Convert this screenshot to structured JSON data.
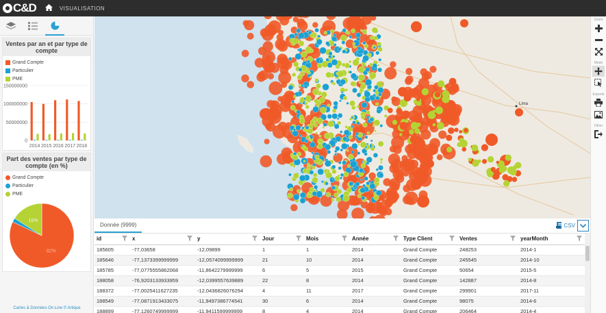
{
  "app": {
    "logo": "C&D",
    "nav_title": "VISUALISATION"
  },
  "sidebar": {
    "bar_panel": {
      "title": "Ventes par an et par type de compte",
      "legend": [
        {
          "label": "Grand Compte",
          "color": "#f05a28"
        },
        {
          "label": "Particulier",
          "color": "#1ba1d2"
        },
        {
          "label": "PME",
          "color": "#b5d334"
        }
      ]
    },
    "pie_panel": {
      "title": "Part des ventes par type de compte (en %)",
      "legend": [
        {
          "label": "Grand Compte",
          "color": "#f05a28"
        },
        {
          "label": "Particulier",
          "color": "#1ba1d2"
        },
        {
          "label": "PME",
          "color": "#b5d334"
        }
      ]
    },
    "footer": "Cartes & Données On Line © Artique"
  },
  "chart_data": [
    {
      "type": "bar",
      "title": "Ventes par an et par type de compte",
      "categories": [
        "2014",
        "2015",
        "2016",
        "2017",
        "2018"
      ],
      "y_ticks": [
        "150000000",
        "100000000",
        "50000000",
        "0"
      ],
      "ylim": [
        0,
        150000000
      ],
      "series": [
        {
          "name": "Grand Compte",
          "values": [
            105000000,
            100000000,
            110000000,
            112000000,
            108000000
          ]
        },
        {
          "name": "Particulier",
          "values": [
            1500000,
            1400000,
            1600000,
            1500000,
            1400000
          ]
        },
        {
          "name": "PME",
          "values": [
            18000000,
            17000000,
            19000000,
            20000000,
            19000000
          ]
        }
      ]
    },
    {
      "type": "pie",
      "title": "Part des ventes par type de compte (en %)",
      "series": [
        {
          "name": "Grand Compte",
          "value": 82
        },
        {
          "name": "Particulier",
          "value": 2
        },
        {
          "name": "PME",
          "value": 16
        }
      ],
      "data_labels": [
        "82%",
        "",
        "16%"
      ]
    }
  ],
  "map": {
    "labels": [
      {
        "text": "Lima"
      }
    ]
  },
  "toolbar": {
    "zoom_label": "Zoom",
    "mode_label": "Mode",
    "export_label": "Exports",
    "other_label": "Other"
  },
  "data": {
    "tab_label": "Donnée (9999)",
    "csv_label": "CSV",
    "columns": [
      "id",
      "x",
      "y",
      "Jour",
      "Mois",
      "Année",
      "Type Client",
      "Ventes",
      "yearMonth"
    ],
    "rows": [
      [
        "185605",
        "-77,03658",
        "-12,09899",
        "1",
        "1",
        "2014",
        "Grand Compte",
        "248253",
        "2014-1"
      ],
      [
        "185646",
        "-77,1373399999999",
        "-12,0574099999999",
        "21",
        "10",
        "2014",
        "Grand Compte",
        "245545",
        "2014-10"
      ],
      [
        "185785",
        "-77,0775555862068",
        "-11,8642279999999",
        "6",
        "5",
        "2015",
        "Grand Compte",
        "50654",
        "2015-5"
      ],
      [
        "188058",
        "-76,9203133933959",
        "-12,0399557639889",
        "22",
        "8",
        "2014",
        "Grand Compte",
        "142887",
        "2014-8"
      ],
      [
        "188372",
        "-77,0025411627235",
        "-12,0436826076294",
        "4",
        "11",
        "2017",
        "Grand Compte",
        "299901",
        "2017-11"
      ],
      [
        "188549",
        "-77,0871913433075",
        "-11,9497386774541",
        "30",
        "6",
        "2014",
        "Grand Compte",
        "98075",
        "2014-6"
      ],
      [
        "188899",
        "-77,1260749999999",
        "-11,9411599999999",
        "8",
        "4",
        "2014",
        "Grand Compte",
        "206464",
        "2014-4"
      ]
    ]
  }
}
